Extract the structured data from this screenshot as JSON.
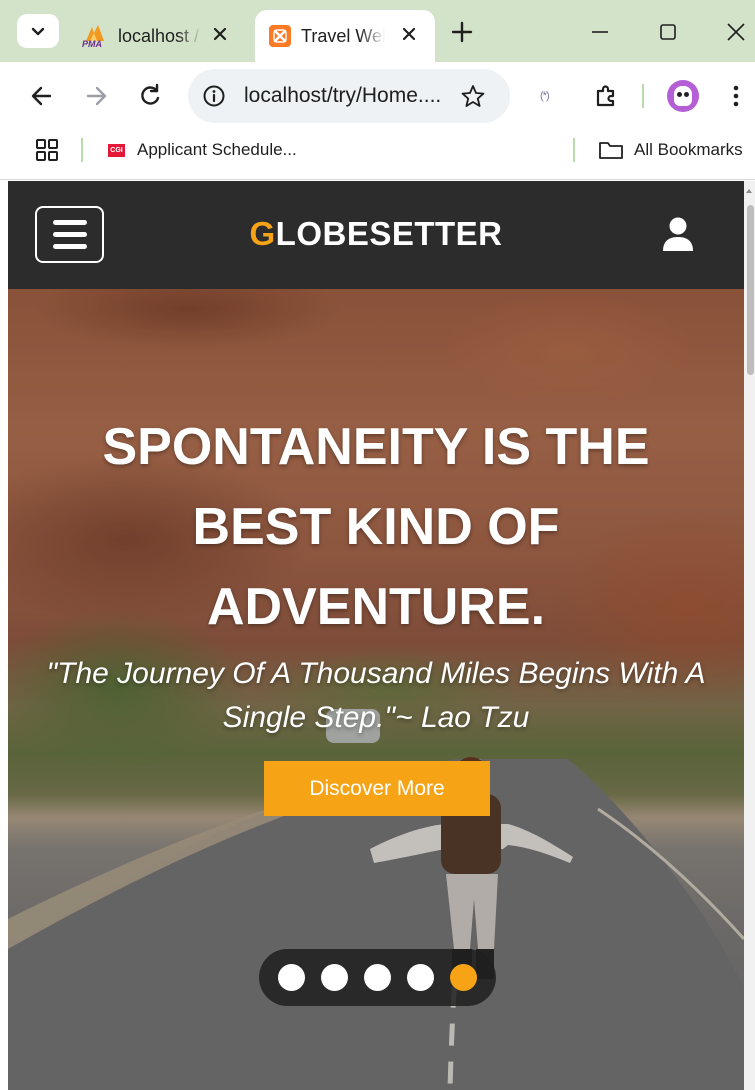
{
  "browser": {
    "tabs": [
      {
        "title": "localhost /",
        "favicon": "phpmyadmin-icon",
        "favicon_text": "PMA",
        "active": false
      },
      {
        "title": "Travel Wel",
        "favicon": "xampp-icon",
        "active": true
      }
    ],
    "address": {
      "url": "localhost/try/Home...."
    },
    "extension_label": "(*)",
    "bookmarks": [
      {
        "label": "Applicant Schedule...",
        "icon": "cgi-icon",
        "icon_text": "CGI"
      }
    ],
    "all_bookmarks_label": "All Bookmarks"
  },
  "site": {
    "logo_first_letter": "G",
    "logo_rest": "LOBESETTER",
    "hero": {
      "title": "SPONTANEITY IS THE BEST KIND OF ADVENTURE.",
      "quote": "\"The Journey Of A Thousand Miles Begins With A Single Step.\"~ Lao Tzu",
      "button_label": "Discover More"
    },
    "carousel": {
      "count": 5,
      "active_index": 4
    }
  },
  "colors": {
    "accent": "#f6a316",
    "header_bg": "#2c2c2c",
    "tabstrip_bg": "#d3e3c9"
  }
}
